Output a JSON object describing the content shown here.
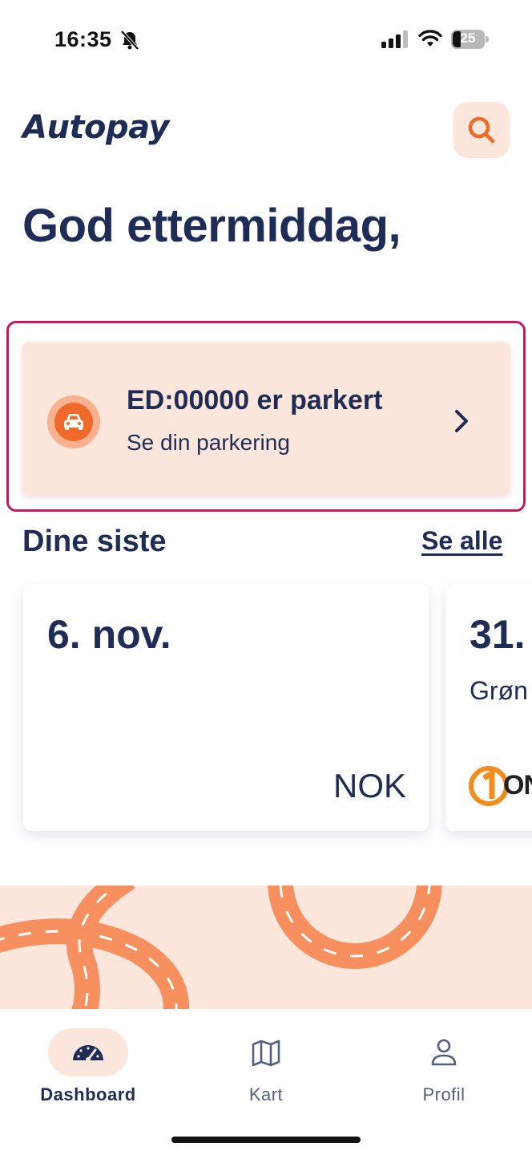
{
  "status_bar": {
    "time": "16:35",
    "battery": "25",
    "icons": [
      "bell-slash-icon",
      "signal-icon",
      "wifi-icon",
      "battery-icon"
    ]
  },
  "header": {
    "logo": "Autopay",
    "search_icon": "search-icon"
  },
  "greeting": "God ettermiddag,",
  "parking": {
    "title": "ED:00000 er parkert",
    "subtitle": "Se din parkering",
    "icon": "car-icon",
    "chevron": "chevron-right-icon"
  },
  "recent": {
    "title": "Dine siste",
    "see_all": "Se alle",
    "cards": [
      {
        "date": "6. nov.",
        "place": "",
        "amount": "NOK"
      },
      {
        "date": "31.",
        "place": "Grøn",
        "operator": "ON"
      }
    ]
  },
  "colors": {
    "primary": "#1f2c55",
    "accent": "#ef6a2a",
    "accent_light": "#fde6dc",
    "highlight": "#c8175d",
    "road": "#f7905e"
  },
  "nav": {
    "items": [
      {
        "label": "Dashboard",
        "icon": "speedometer-icon",
        "active": true
      },
      {
        "label": "Kart",
        "icon": "map-icon",
        "active": false
      },
      {
        "label": "Profil",
        "icon": "user-icon",
        "active": false
      }
    ]
  }
}
